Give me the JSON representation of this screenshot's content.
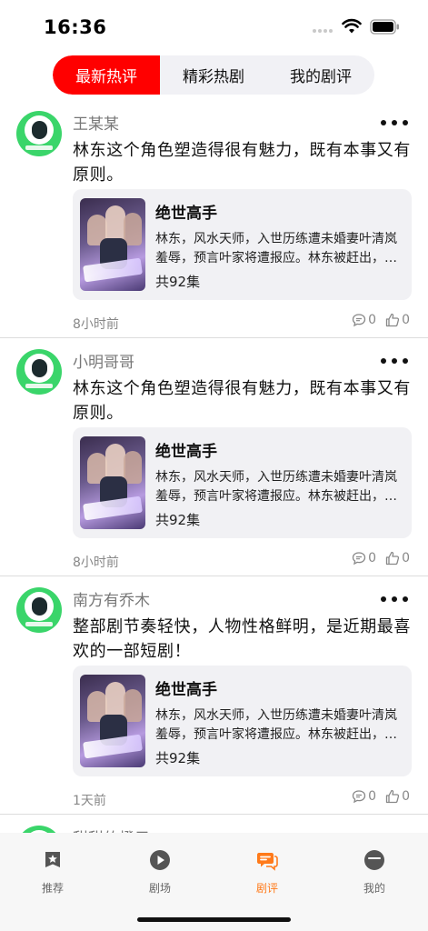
{
  "status_bar": {
    "time": "16:36"
  },
  "segments": [
    {
      "label": "最新热评",
      "active": true
    },
    {
      "label": "精彩热剧",
      "active": false
    },
    {
      "label": "我的剧评",
      "active": false
    }
  ],
  "posts": [
    {
      "username": "王某某",
      "text": "林东这个角色塑造得很有魅力，既有本事又有原则。",
      "drama": {
        "title": "绝世高手",
        "desc_line1": "林东，风水天师，入世历练遭未婚妻叶清岚",
        "desc_line2": "羞辱，预言叶家将遭报应。林东被赶出，…",
        "count": "共92集"
      },
      "time": "8小时前",
      "comments": "0",
      "likes": "0"
    },
    {
      "username": "小明哥哥",
      "text": "林东这个角色塑造得很有魅力，既有本事又有原则。",
      "drama": {
        "title": "绝世高手",
        "desc_line1": "林东，风水天师，入世历练遭未婚妻叶清岚",
        "desc_line2": "羞辱，预言叶家将遭报应。林东被赶出，…",
        "count": "共92集"
      },
      "time": "8小时前",
      "comments": "0",
      "likes": "0"
    },
    {
      "username": "南方有乔木",
      "text": "整部剧节奏轻快，人物性格鲜明，是近期最喜欢的一部短剧！",
      "drama": {
        "title": "绝世高手",
        "desc_line1": "林东，风水天师，入世历练遭未婚妻叶清岚",
        "desc_line2": "羞辱，预言叶家将遭报应。林东被赶出，…",
        "count": "共92集"
      },
      "time": "1天前",
      "comments": "0",
      "likes": "0"
    },
    {
      "username": "甜甜的橙子"
    }
  ],
  "tab_bar": [
    {
      "label": "推荐",
      "icon": "star-badge-icon",
      "active": false
    },
    {
      "label": "剧场",
      "icon": "play-circle-icon",
      "active": false
    },
    {
      "label": "剧评",
      "icon": "chat-bubbles-icon",
      "active": true
    },
    {
      "label": "我的",
      "icon": "profile-icon",
      "active": false
    }
  ],
  "colors": {
    "accent": "#ff0000",
    "tab_active": "#ff7a1a",
    "avatar_green": "#3ad56a"
  }
}
